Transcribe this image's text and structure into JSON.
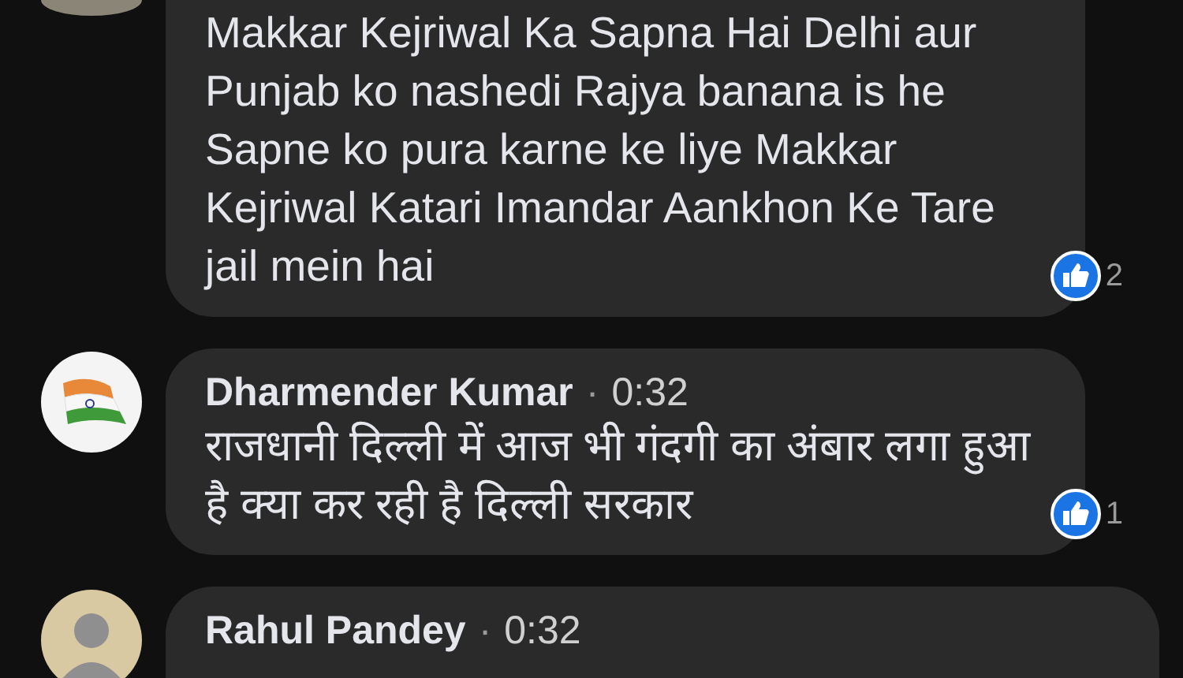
{
  "comments": [
    {
      "kind": "partial",
      "text": "Makkar Kejriwal Ka Sapna Hai Delhi aur Punjab ko nashedi Rajya banana is he Sapne ko pura karne ke liye Makkar Kejriwal Katari Imandar Aankhon Ke Tare jail mein hai",
      "reactions": "2"
    },
    {
      "kind": "flag",
      "author": "Dharmender Kumar",
      "separator": "·",
      "time": "0:32",
      "text": "राजधानी दिल्ली में आज भी गंदगी का अंबार लगा हुआ है क्या कर रही है दिल्ली सरकार",
      "reactions": "1"
    },
    {
      "kind": "photo",
      "author": "Rahul Pandey",
      "separator": "·",
      "time": "0:32"
    }
  ]
}
